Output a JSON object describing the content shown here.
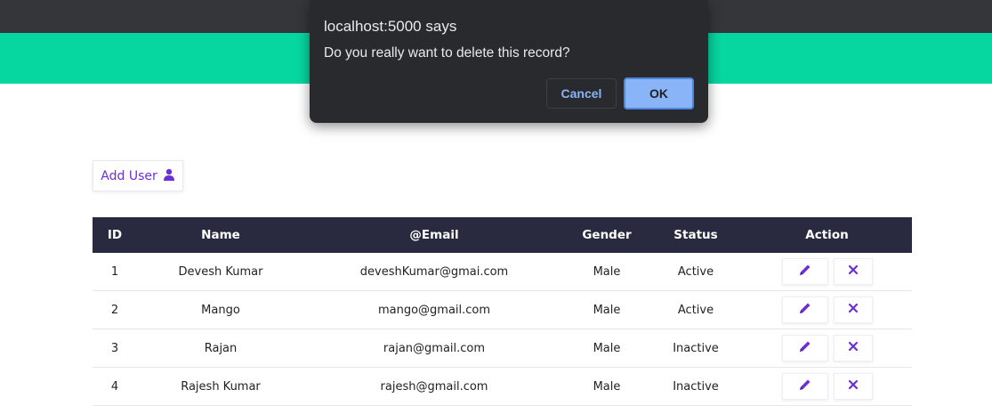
{
  "dialog": {
    "title": "localhost:5000 says",
    "message": "Do you really want to delete this record?",
    "cancel_label": "Cancel",
    "ok_label": "OK"
  },
  "toolbar": {
    "add_user_label": "Add User",
    "add_user_icon": "user-icon"
  },
  "table": {
    "headers": {
      "id": "ID",
      "name": "Name",
      "email": "@Email",
      "gender": "Gender",
      "status": "Status",
      "action": "Action"
    },
    "rows": [
      {
        "id": "1",
        "name": "Devesh Kumar",
        "email": "deveshKumar@gmai.com",
        "gender": "Male",
        "status": "Active"
      },
      {
        "id": "2",
        "name": "Mango",
        "email": "mango@gmail.com",
        "gender": "Male",
        "status": "Active"
      },
      {
        "id": "3",
        "name": "Rajan",
        "email": "rajan@gmail.com",
        "gender": "Male",
        "status": "Inactive"
      },
      {
        "id": "4",
        "name": "Rajesh Kumar",
        "email": "rajesh@gmail.com",
        "gender": "Male",
        "status": "Inactive"
      }
    ],
    "action_icons": {
      "edit": "pencil-icon",
      "delete": "close-icon"
    }
  },
  "colors": {
    "browser_bar": "#35363a",
    "header_band": "#06d6a0",
    "accent_purple": "#6a2fd6",
    "table_header": "#292a3f",
    "dialog_bg": "#292a2d",
    "dialog_ok": "#8ab4f8"
  }
}
